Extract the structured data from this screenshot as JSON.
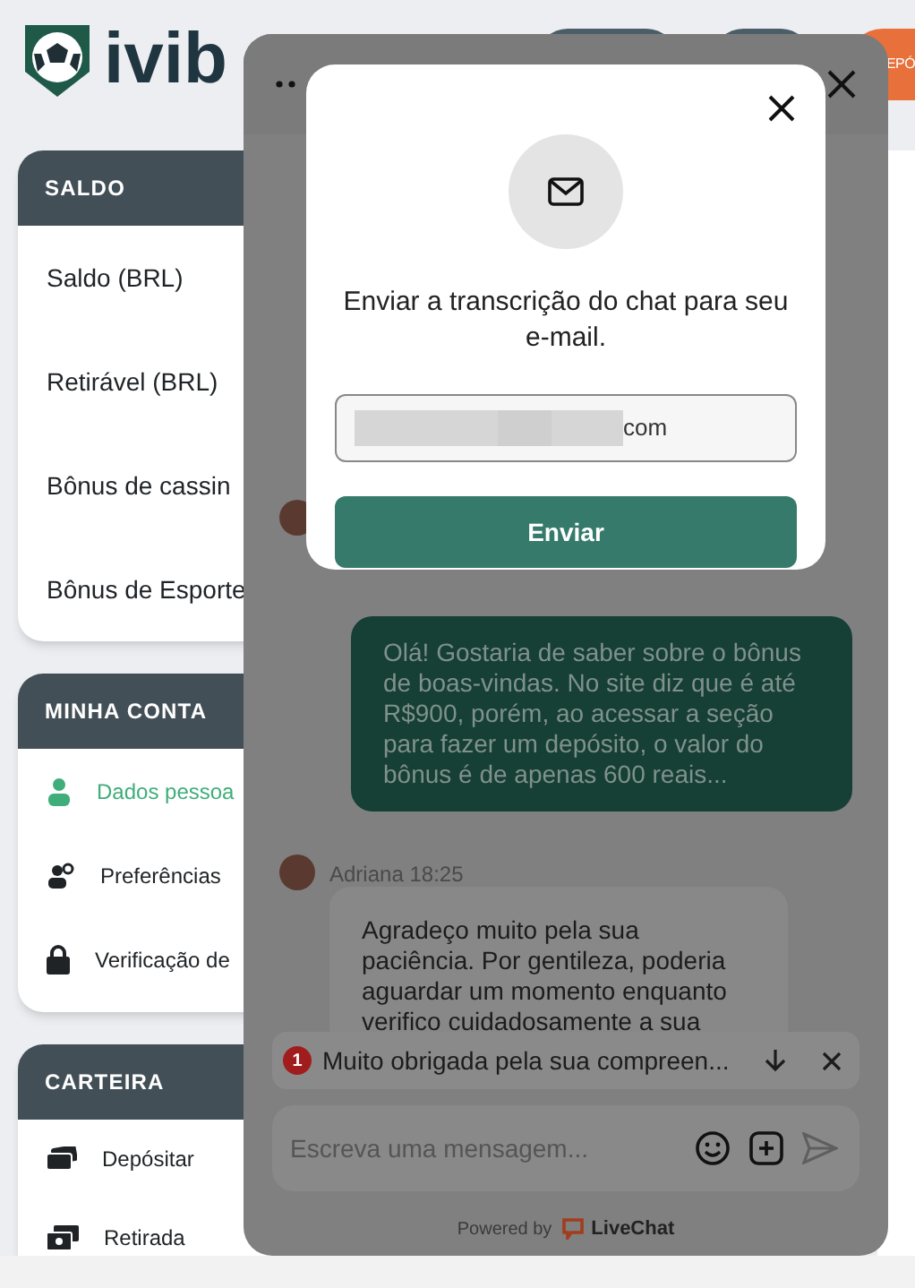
{
  "header": {
    "logo_text": "ivib",
    "deposit_button": "EPÓ"
  },
  "sidebar": [
    {
      "title": "SALDO",
      "items": [
        {
          "label": "Saldo (BRL)"
        },
        {
          "label": "Retirável (BRL)"
        },
        {
          "label": "Bônus de cassin"
        },
        {
          "label": "Bônus de Esporte"
        }
      ]
    },
    {
      "title": "MINHA CONTA",
      "items": [
        {
          "label": "Dados pessoa",
          "selected": true
        },
        {
          "label": "Preferências",
          "selected": false
        },
        {
          "label": "Verificação de",
          "selected": false
        }
      ]
    },
    {
      "title": "CARTEIRA",
      "items": [
        {
          "label": "Depósitar"
        },
        {
          "label": "Retirada"
        }
      ]
    }
  ],
  "chat": {
    "user_message": "Olá! Gostaria de saber sobre o bônus de boas-vindas. No site diz que é até R$900, porém, ao acessar a seção para fazer um depósito, o valor do bônus é de apenas 600 reais...",
    "agent": {
      "name": "Adriana",
      "time": "18:25"
    },
    "agent_message_lines": [
      "Agradeço muito pela sua",
      "paciência. Por gentileza, poderia",
      "aguardar um momento enquanto",
      "verifico cuidadosamente a sua"
    ],
    "notification": {
      "count": "1",
      "text": "Muito obrigada pela sua compreen..."
    },
    "composer": {
      "placeholder": "Escreva uma mensagem..."
    },
    "footer": {
      "powered_by": "Powered by",
      "brand": "LiveChat"
    }
  },
  "modal": {
    "text": "Enviar a transcrição do chat para seu e-mail.",
    "email": {
      "value": "com"
    },
    "button": "Enviar"
  }
}
